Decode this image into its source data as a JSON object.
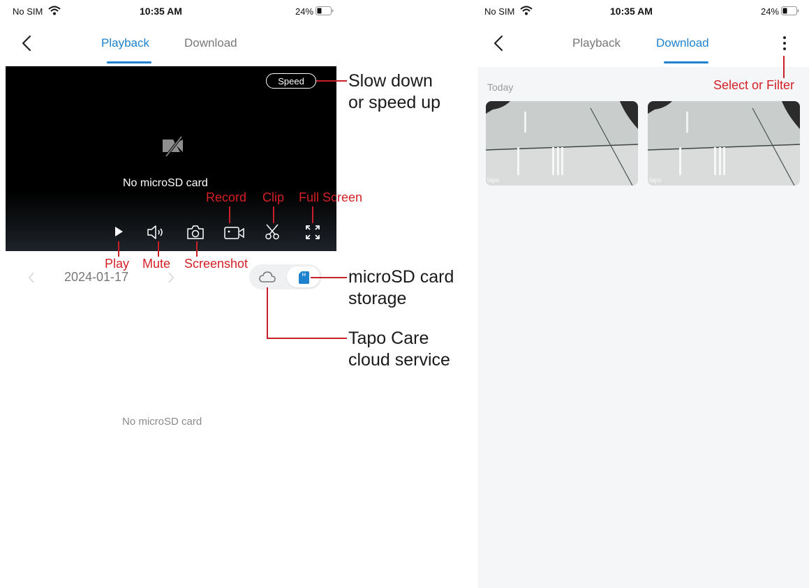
{
  "left_phone": {
    "status": {
      "carrier": "No SIM",
      "time": "10:35 AM",
      "battery": "24%"
    },
    "tabs": [
      {
        "label": "Playback",
        "active": true
      },
      {
        "label": "Download",
        "active": false
      }
    ],
    "player": {
      "speed_label": "Speed",
      "message": "No microSD card"
    },
    "date": {
      "value": "2024-01-17"
    },
    "empty_message": "No microSD card"
  },
  "right_phone": {
    "status": {
      "carrier": "No SIM",
      "time": "10:35 AM",
      "battery": "24%"
    },
    "tabs": [
      {
        "label": "Playback",
        "active": false
      },
      {
        "label": "Download",
        "active": true
      }
    ],
    "section_label": "Today",
    "thumbnails": [
      {
        "watermark": "tapo"
      },
      {
        "watermark": "tapo"
      }
    ]
  },
  "annotations": {
    "speed": [
      "Slow down",
      "or speed up"
    ],
    "record": "Record",
    "clip": "Clip",
    "fullscreen": "Full Screen",
    "play": "Play",
    "mute": "Mute",
    "screenshot": "Screenshot",
    "microsd": [
      "microSD card",
      "storage"
    ],
    "cloud": [
      "Tapo Care",
      "cloud service"
    ],
    "select_filter": "Select or Filter"
  },
  "colors": {
    "accent": "#1f82cf",
    "annotation_red": "#d42027"
  },
  "icons": [
    "wifi-icon",
    "battery-icon",
    "back-arrow-icon",
    "no-video-icon",
    "play-icon",
    "volume-icon",
    "camera-icon",
    "record-icon",
    "scissors-icon",
    "fullscreen-icon",
    "chevron-left-icon",
    "chevron-right-icon",
    "cloud-icon",
    "sd-card-icon",
    "more-vertical-icon"
  ]
}
